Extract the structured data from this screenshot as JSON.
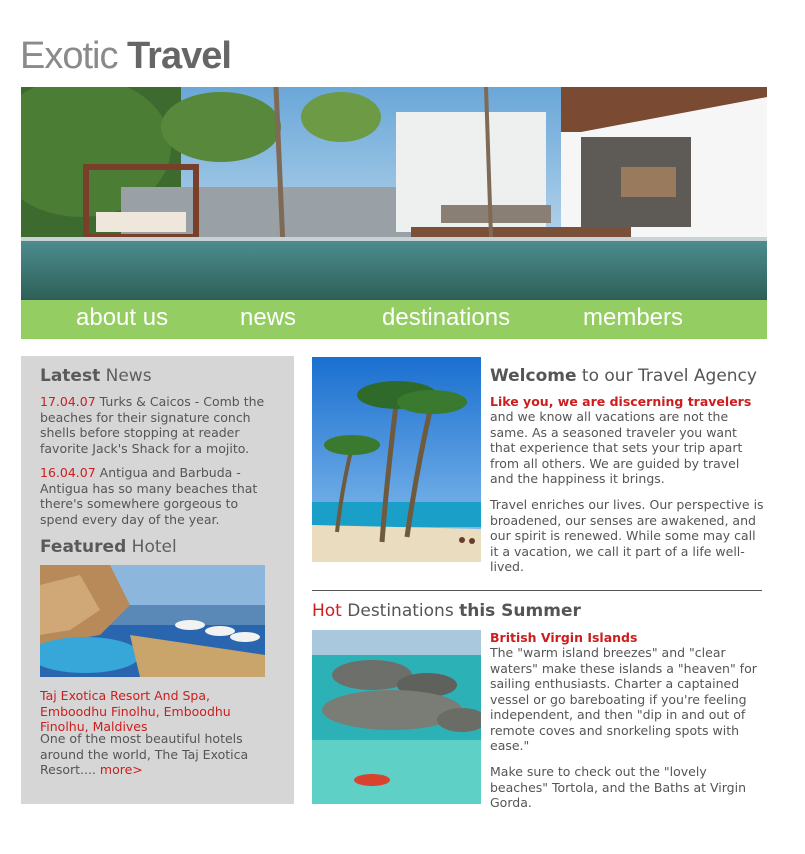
{
  "logo": {
    "light": "Exotic",
    "bold": "Travel"
  },
  "nav": {
    "items": [
      "about us",
      "news",
      "destinations",
      "members"
    ]
  },
  "sidebar": {
    "news_heading_bold": "Latest",
    "news_heading_rest": "News",
    "news": [
      {
        "date": "17.04.07",
        "text": "Turks & Caicos - Comb the beaches for their signature conch shells before stopping at reader favorite Jack's Shack for a mojito."
      },
      {
        "date": "16.04.07",
        "text": "Antigua and Barbuda - Antigua has so many beaches that there's somewhere gorgeous to spend every day of the year."
      }
    ],
    "featured_heading_bold": "Featured",
    "featured_heading_rest": "Hotel",
    "hotel_name": "Taj Exotica Resort And Spa, Emboodhu Finolhu, Emboodhu Finolhu, Maldives",
    "hotel_desc": "One of the most beautiful hotels around the world, The Taj Exotica Resort....",
    "more_label": "more>"
  },
  "welcome": {
    "heading_bold": "Welcome",
    "heading_rest": "to our Travel Agency",
    "tagline": "Like you, we are discerning travelers",
    "para1": "and we know all vacations are not the same. As a seasoned traveler you want that experience that sets your trip apart from all others. We are guided by travel and the happiness it brings.",
    "para2": "Travel enriches our lives. Our perspective is broadened, our senses are awakened, and our spirit is renewed. While some may call it a vacation, we call it part of a life well-lived."
  },
  "hot": {
    "heading_red": "Hot",
    "heading_mid": "Destinations",
    "heading_bold": "this Summer",
    "title": "British Virgin Islands",
    "para1": "The \"warm island breezes\" and \"clear waters\" make these islands a \"heaven\" for sailing enthusiasts. Charter a captained vessel or go bareboating if you're feeling independent, and then \"dip in and out of remote coves and snorkeling spots with ease.\"",
    "para2": "Make sure to check out the \"lovely beaches\" Tortola, and the Baths at Virgin Gorda."
  },
  "colors": {
    "accent_red": "#cc1e1e",
    "nav_green": "#94cd62",
    "sidebar_gray": "#d6d6d6"
  }
}
